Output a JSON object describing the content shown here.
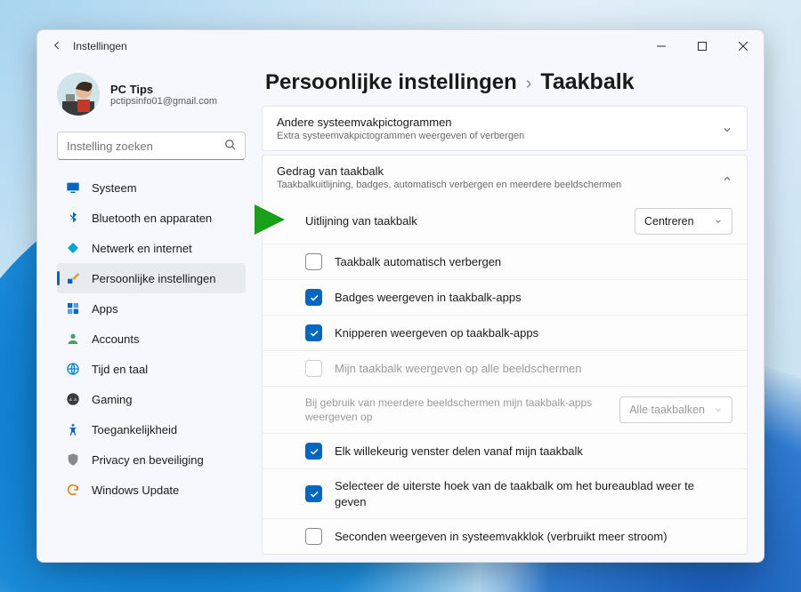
{
  "titlebar": {
    "title": "Instellingen"
  },
  "profile": {
    "name": "PC Tips",
    "email": "pctipsinfo01@gmail.com"
  },
  "search": {
    "placeholder": "Instelling zoeken"
  },
  "nav": {
    "items": [
      {
        "label": "Systeem"
      },
      {
        "label": "Bluetooth en apparaten"
      },
      {
        "label": "Netwerk en internet"
      },
      {
        "label": "Persoonlijke instellingen"
      },
      {
        "label": "Apps"
      },
      {
        "label": "Accounts"
      },
      {
        "label": "Tijd en taal"
      },
      {
        "label": "Gaming"
      },
      {
        "label": "Toegankelijkheid"
      },
      {
        "label": "Privacy en beveiliging"
      },
      {
        "label": "Windows Update"
      }
    ]
  },
  "breadcrumb": {
    "parent": "Persoonlijke instellingen",
    "sep": "›",
    "current": "Taakbalk"
  },
  "card_other": {
    "title": "Andere systeemvakpictogrammen",
    "sub": "Extra systeemvakpictogrammen weergeven of verbergen"
  },
  "card_behavior": {
    "title": "Gedrag van taakbalk",
    "sub": "Taakbalkuitlijning, badges, automatisch verbergen en meerdere beeldschermen"
  },
  "rows": {
    "alignment_label": "Uitlijning van taakbalk",
    "alignment_value": "Centreren",
    "hide": "Taakbalk automatisch verbergen",
    "badges": "Badges weergeven in taakbalk-apps",
    "flash": "Knipperen weergeven op taakbalk-apps",
    "all_monitors": "Mijn taakbalk weergeven op alle beeldschermen",
    "multi_label": "Bij gebruik van meerdere beeldschermen mijn taakbalk-apps weergeven op",
    "multi_value": "Alle taakbalken",
    "share": "Elk willekeurig venster delen vanaf mijn taakbalk",
    "corner": "Selecteer de uiterste hoek van de taakbalk om het bureaublad weer te geven",
    "seconds": "Seconden weergeven in systeemvakklok (verbruikt meer stroom)"
  }
}
